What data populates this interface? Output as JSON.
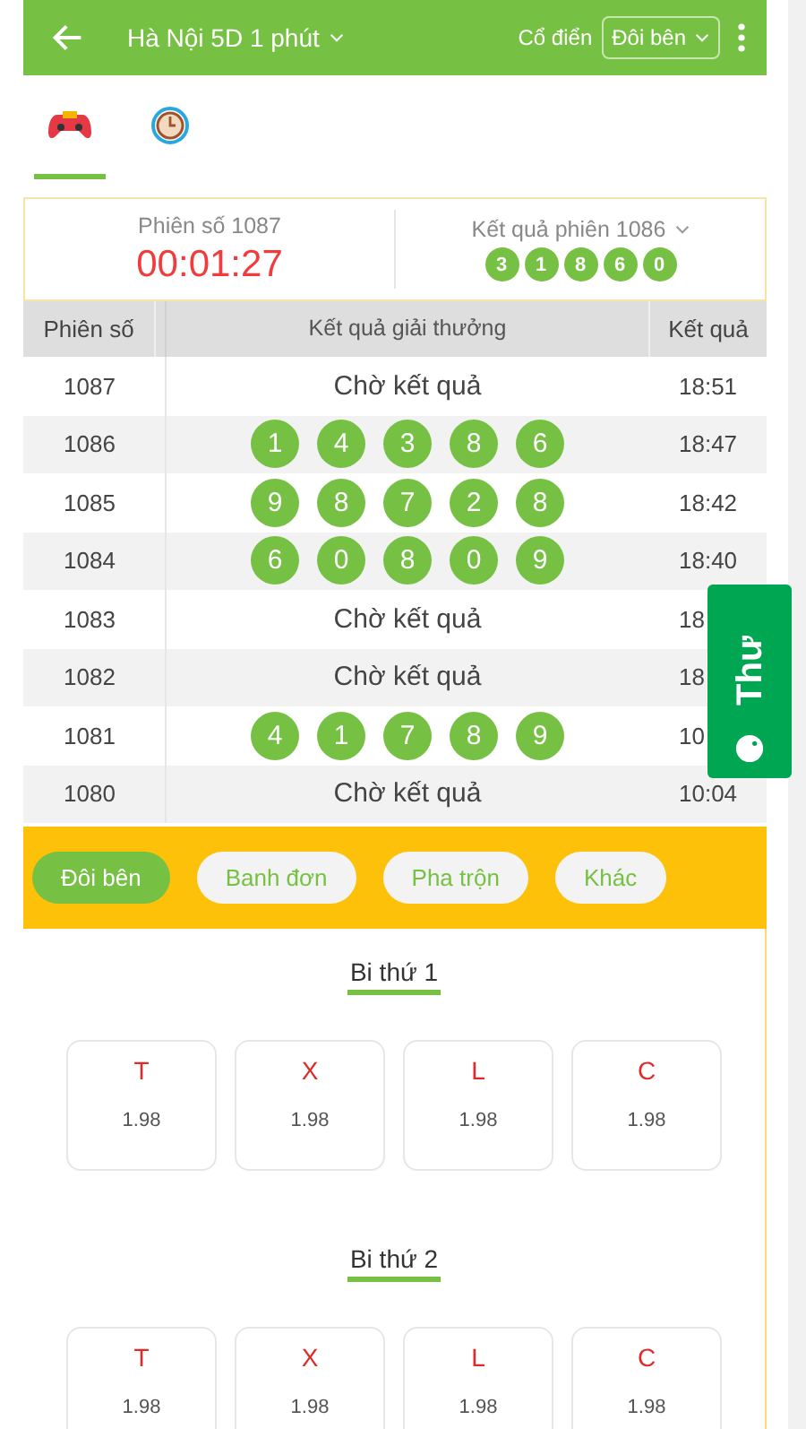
{
  "header": {
    "title": "Hà Nội 5D 1 phút",
    "mode": "Cổ điển",
    "select": "Đôi bên"
  },
  "icon_tabs": [
    {
      "kind": "game",
      "selected": true
    },
    {
      "kind": "history",
      "selected": false
    }
  ],
  "current": {
    "session": "Phiên số 1087",
    "countdown": "00:01:27",
    "last_label": "Kết quả phiên 1086",
    "last_balls": [
      "3",
      "1",
      "8",
      "6",
      "0"
    ]
  },
  "table": {
    "columns": [
      "Phiên số",
      "Kết quả giải thưởng",
      "Kết quả"
    ],
    "rows": [
      {
        "session": "1087",
        "kind": "pending",
        "text": "Chờ kết quả",
        "time": "18:51"
      },
      {
        "session": "1086",
        "kind": "balls",
        "balls": [
          "1",
          "4",
          "3",
          "8",
          "6"
        ],
        "time": "18:47"
      },
      {
        "session": "1085",
        "kind": "balls",
        "balls": [
          "9",
          "8",
          "7",
          "2",
          "8"
        ],
        "time": "18:42"
      },
      {
        "session": "1084",
        "kind": "balls",
        "balls": [
          "6",
          "0",
          "8",
          "0",
          "9"
        ],
        "time": "18:40"
      },
      {
        "session": "1083",
        "kind": "pending",
        "text": "Chờ kết quả",
        "time": "18"
      },
      {
        "session": "1082",
        "kind": "pending",
        "text": "Chờ kết quả",
        "time": "18"
      },
      {
        "session": "1081",
        "kind": "balls",
        "balls": [
          "4",
          "1",
          "7",
          "8",
          "9"
        ],
        "time": "10"
      },
      {
        "session": "1080",
        "kind": "pending",
        "text": "Chờ kết quả",
        "time": "10:04"
      }
    ]
  },
  "float_tab": {
    "label": "Thư"
  },
  "bet_tabs": [
    {
      "label": "Đôi bên",
      "selected": true
    },
    {
      "label": "Banh đơn",
      "selected": false
    },
    {
      "label": "Pha trộn",
      "selected": false
    },
    {
      "label": "Khác",
      "selected": false
    }
  ],
  "sections": [
    {
      "title": "Bi thứ 1",
      "options": [
        {
          "label": "T",
          "odds": "1.98"
        },
        {
          "label": "X",
          "odds": "1.98"
        },
        {
          "label": "L",
          "odds": "1.98"
        },
        {
          "label": "C",
          "odds": "1.98"
        }
      ]
    },
    {
      "title": "Bi thứ 2",
      "options": [
        {
          "label": "T",
          "odds": "1.98"
        },
        {
          "label": "X",
          "odds": "1.98"
        },
        {
          "label": "L",
          "odds": "1.98"
        },
        {
          "label": "C",
          "odds": "1.98"
        }
      ]
    }
  ]
}
